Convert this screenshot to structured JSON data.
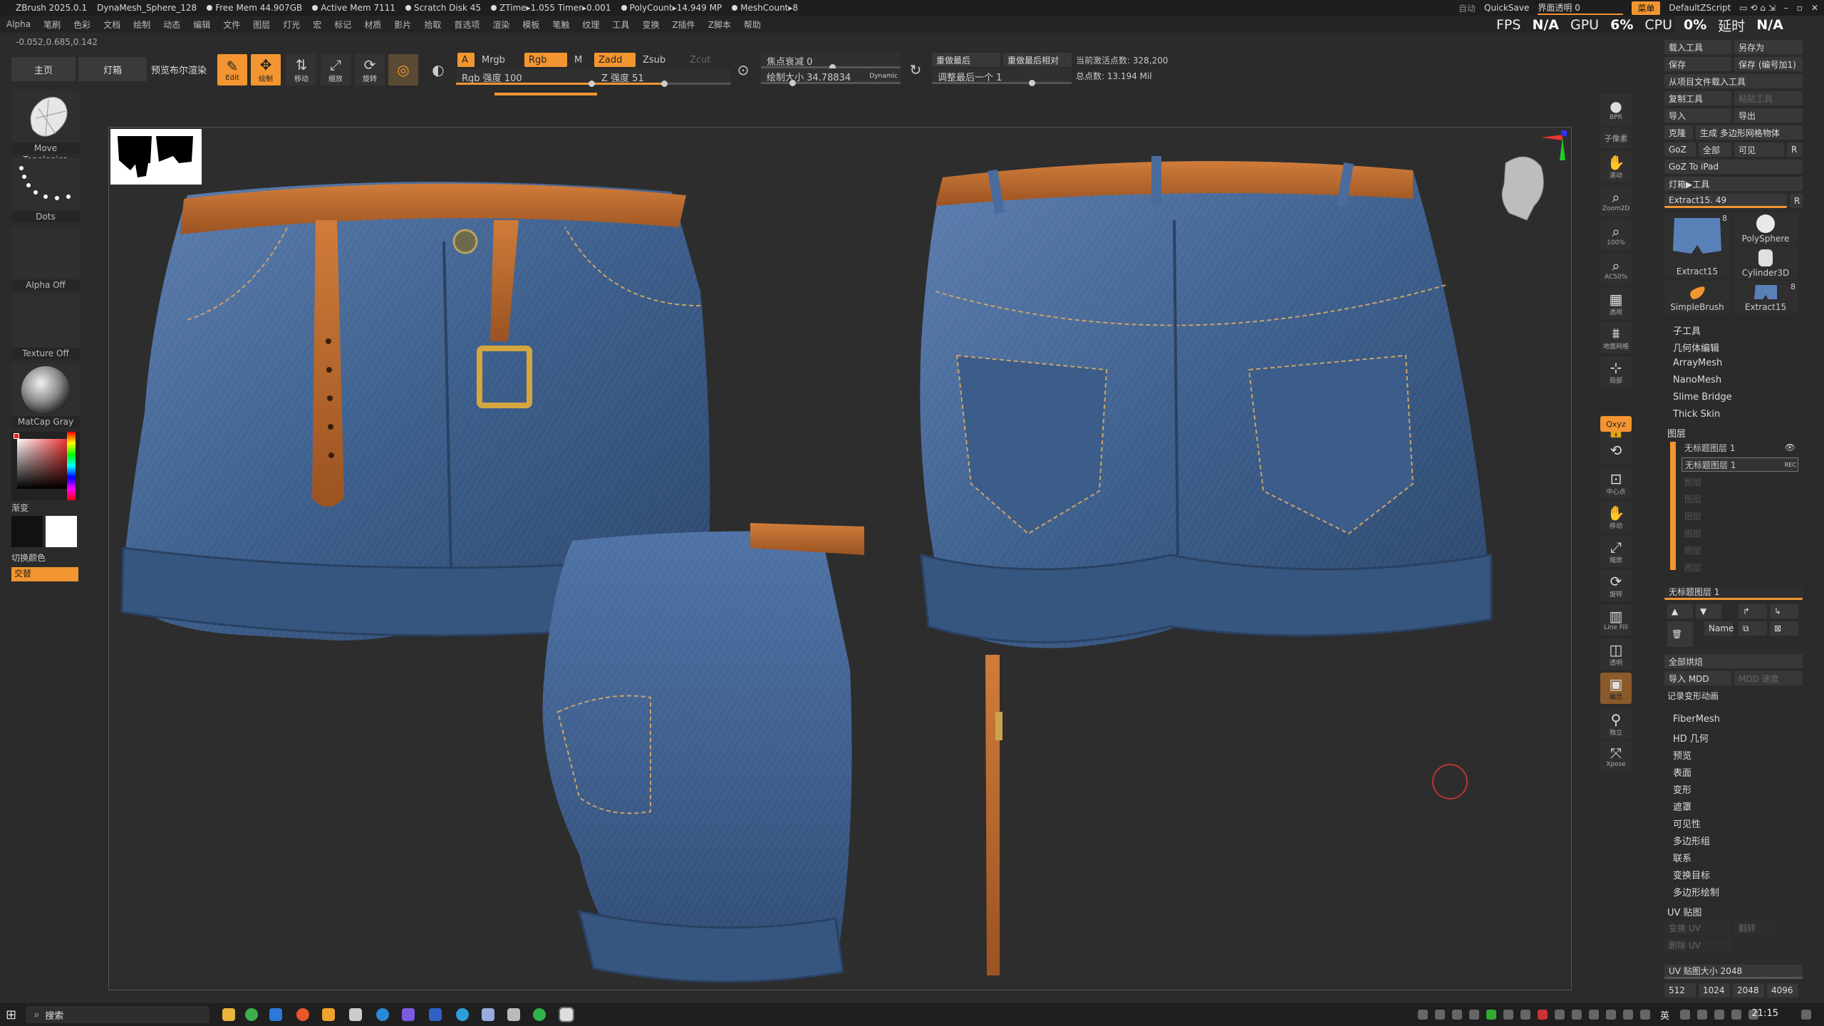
{
  "titlebar": {
    "app": "ZBrush 2025.0.1",
    "mesh": "DynaMesh_Sphere_128",
    "stats": [
      "Free Mem 44.907GB",
      "Active Mem 7111",
      "Scratch Disk 45",
      "ZTime▸1.055 Timer▸0.001",
      "PolyCount▸14.949 MP",
      "MeshCount▸8"
    ],
    "auto": "自动",
    "quicksave": "QuickSave",
    "transparency": "界面透明 0",
    "menu_btn": "菜单",
    "zscript": "DefaultZScript"
  },
  "menu": [
    "Alpha",
    "笔刷",
    "色彩",
    "文档",
    "绘制",
    "动态",
    "编辑",
    "文件",
    "图层",
    "灯光",
    "宏",
    "标记",
    "材质",
    "影片",
    "拾取",
    "首选项",
    "渲染",
    "模板",
    "笔触",
    "纹理",
    "工具",
    "变换",
    "Z插件",
    "Z脚本",
    "帮助"
  ],
  "perf": {
    "fps_label": "FPS",
    "fps": "N/A",
    "gpu_label": "GPU",
    "gpu": "6%",
    "cpu_label": "CPU",
    "cpu": "0%",
    "delay_label": "延时",
    "delay": "N/A"
  },
  "coords": "-0.052,0.685,0.142",
  "toolbar": {
    "home": "主页",
    "lightbox": "灯箱",
    "preview": "预览布尔渲染",
    "edit": "Edit",
    "draw": "绘制",
    "move": "移动",
    "scale": "缩放",
    "rotate": "旋转",
    "a": "A",
    "mrgb": "Mrgb",
    "rgb": "Rgb",
    "m": "M",
    "zadd": "Zadd",
    "zsub": "Zsub",
    "zcut": "Zcut",
    "rgb_intensity": "Rgb 强度 100",
    "z_intensity": "Z 强度 51",
    "focal": "焦点衰减 0",
    "draw_size": "绘制大小 34.78834",
    "dynamic": "Dynamic",
    "replay_last": "重做最后",
    "replay_rel": "重做最后相对",
    "adjust_last": "调整最后一个 1",
    "active_points": "当前激活点数: 328,200",
    "total_points": "总点数: 13.194 Mil"
  },
  "left": {
    "brush": "Move Topologica",
    "stroke": "Dots",
    "alpha": "Alpha Off",
    "texture": "Texture Off",
    "material": "MatCap Gray",
    "gradient": "渐变",
    "switch": "切换颜色",
    "alternate": "交替"
  },
  "rightcol": [
    "BPR",
    "子像素",
    "滚动",
    "Zoom2D",
    "100%",
    "AC50%",
    "透视",
    "地面网格",
    "局部",
    "Qxyz",
    "中心点",
    "移动",
    "缩放",
    "旋转",
    "Line Fill",
    "透明",
    "幽灵",
    "独立",
    "Xpose"
  ],
  "tool": {
    "load": "载入工具",
    "saveas": "另存为",
    "save": "保存",
    "save_inc": "保存 (编号加1)",
    "load_project": "从项目文件载入工具",
    "copy": "复制工具",
    "paste": "粘贴工具",
    "import": "导入",
    "export": "导出",
    "clone": "克隆",
    "make_poly": "生成 多边形网格物体",
    "goz": "GoZ",
    "all": "全部",
    "visible": "可见",
    "r": "R",
    "goz_ipad": "GoZ To iPad",
    "lightbox_tool": "灯箱▶工具",
    "current": "Extract15. 49",
    "thumbs": [
      {
        "name": "Extract15",
        "count": "8"
      },
      {
        "name": "PolySphere",
        "count": ""
      },
      {
        "name": "Cylinder3D",
        "count": ""
      },
      {
        "name": "SimpleBrush",
        "count": ""
      },
      {
        "name": "Extract15",
        "count": "8"
      }
    ],
    "sections1": [
      "子工具",
      "几何体编辑",
      "ArrayMesh",
      "NanoMesh",
      "Slime Bridge",
      "Thick Skin",
      "图层"
    ],
    "layer1": "无标题图层 1",
    "layer2": "无标题图层 1",
    "rec": "REC",
    "empty_layers": [
      "图层",
      "图层",
      "图层",
      "图层",
      "图层",
      "图层"
    ],
    "layer_name": "无标题图层 1",
    "name_btn": "Name",
    "bake_all": "全部烘焙",
    "import_mdd": "导入 MDD",
    "mdd_speed": "MDD 速度",
    "record_anim": "记录变形动画",
    "sections2": [
      "FiberMesh",
      "HD 几何",
      "预览",
      "表面",
      "变形",
      "遮罩",
      "可见性",
      "多边形组",
      "联系",
      "变换目标",
      "多边形绘制"
    ],
    "uv": "UV 贴图",
    "uv_change": "变换 UV",
    "uv_flip": "翻转",
    "uv_delete": "删除 UV",
    "uv_size": "UV 贴图大小 2048",
    "uv_sizes": [
      "512",
      "1024",
      "2048",
      "4096"
    ]
  },
  "taskbar": {
    "search": "搜索",
    "time": "21:15",
    "ime": "英"
  },
  "colors": {
    "accent": "#f39530",
    "denim": "#3d5f8c",
    "belt": "#b8692e",
    "bg": "#2b2b2b"
  }
}
